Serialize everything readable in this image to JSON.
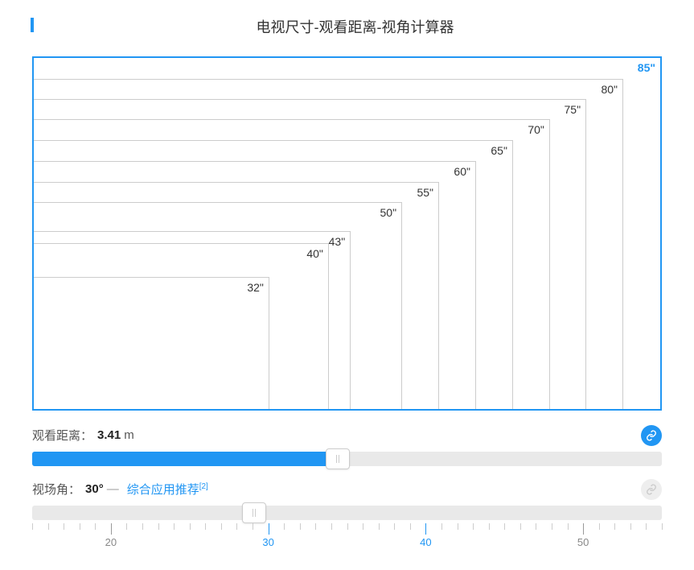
{
  "title": "电视尺寸-观看距离-视角计算器",
  "tv_sizes": [
    {
      "label": "32\"",
      "w": 37.6,
      "h": 21.2
    },
    {
      "label": "40\"",
      "w": 47.1,
      "h": 26.5
    },
    {
      "label": "43\"",
      "w": 50.6,
      "h": 28.5
    },
    {
      "label": "50\"",
      "w": 58.8,
      "h": 33.1
    },
    {
      "label": "55\"",
      "w": 64.7,
      "h": 36.4
    },
    {
      "label": "60\"",
      "w": 70.6,
      "h": 39.7
    },
    {
      "label": "65\"",
      "w": 76.5,
      "h": 43.0
    },
    {
      "label": "70\"",
      "w": 82.4,
      "h": 46.4
    },
    {
      "label": "75\"",
      "w": 88.2,
      "h": 49.6
    },
    {
      "label": "80\"",
      "w": 94.1,
      "h": 52.9
    },
    {
      "label": "85\"",
      "w": 100.0,
      "h": 56.2,
      "selected": true
    }
  ],
  "distance": {
    "label": "观看距离：",
    "value": "3.41",
    "unit": "m",
    "slider_pct": 48.5
  },
  "angle": {
    "label": "视场角：",
    "value": "30°",
    "separator": "—",
    "rec_text": "综合应用推荐",
    "ref": "[2]",
    "slider_pct": 35.3
  },
  "ruler": {
    "min": 15,
    "max": 55,
    "minor_step": 1,
    "major_labels": [
      20,
      30,
      40,
      50
    ],
    "highlight": [
      30,
      40
    ]
  },
  "chart_data": {
    "type": "bar",
    "title": "电视尺寸-观看距离-视角计算器",
    "categories": [
      "32\"",
      "40\"",
      "43\"",
      "50\"",
      "55\"",
      "60\"",
      "65\"",
      "70\"",
      "75\"",
      "80\"",
      "85\""
    ],
    "series": [
      {
        "name": "width_pct",
        "values": [
          37.6,
          47.1,
          50.6,
          58.8,
          64.7,
          70.6,
          76.5,
          82.4,
          88.2,
          94.1,
          100.0
        ]
      },
      {
        "name": "height_pct",
        "values": [
          21.2,
          26.5,
          28.5,
          33.1,
          36.4,
          39.7,
          43.0,
          46.4,
          49.6,
          52.9,
          56.2
        ]
      }
    ],
    "selected_size": "85\"",
    "viewing_distance_m": 3.41,
    "viewing_angle_deg": 30,
    "angle_ruler_range": [
      15,
      55
    ]
  }
}
